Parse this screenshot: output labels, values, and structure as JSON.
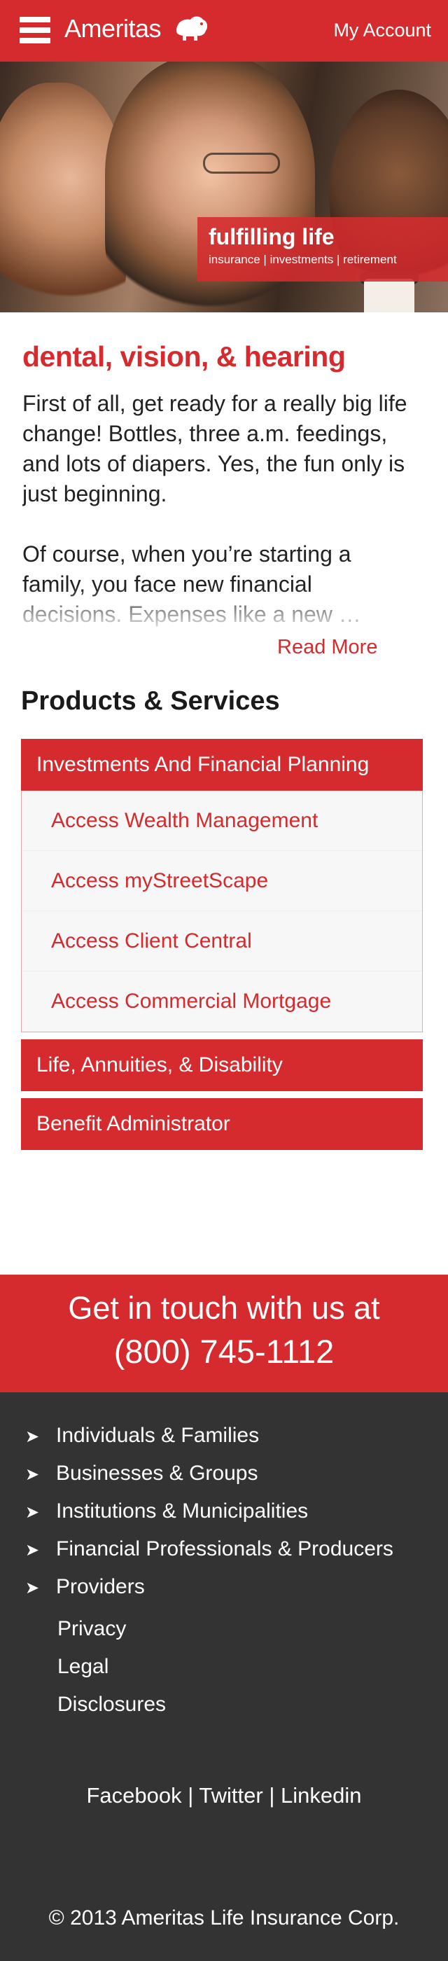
{
  "header": {
    "brand": "Ameritas",
    "account_link": "My Account",
    "brand_color": "#d52b2e"
  },
  "hero": {
    "title": "fulfilling life",
    "subtitle": "insurance | investments | retirement"
  },
  "article": {
    "title": "dental, vision, & hearing",
    "paragraphs": [
      "First of all, get ready for a really big life change! Bottles, three a.m. feedings, and lots of diapers. Yes, the fun only is just beginning.",
      "Of course, when you’re starting a family, you face new financial decisions. Expenses like a new …"
    ],
    "read_more": "Read More"
  },
  "products": {
    "heading": "Products & Services",
    "sections": [
      {
        "label": "Investments And Financial Planning",
        "links": [
          "Access Wealth Management",
          "Access myStreetScape",
          "Access Client Central",
          "Access Commercial Mortgage"
        ]
      },
      {
        "label": "Life, Annuities, & Disability"
      },
      {
        "label": "Benefit Administrator"
      }
    ]
  },
  "contact": {
    "line1": "Get in touch with us at",
    "phone": "(800) 745-1112"
  },
  "footer": {
    "nav_arrow": "➤",
    "nav": [
      "Individuals & Families",
      "Businesses & Groups",
      "Institutions & Municipalities",
      "Financial Professionals & Producers",
      "Providers"
    ],
    "legal": [
      "Privacy",
      "Legal",
      "Disclosures"
    ],
    "social": [
      "Facebook",
      "Twitter",
      "Linkedin"
    ],
    "separator": "|",
    "copyright": "© 2013 Ameritas Life Insurance Corp."
  }
}
